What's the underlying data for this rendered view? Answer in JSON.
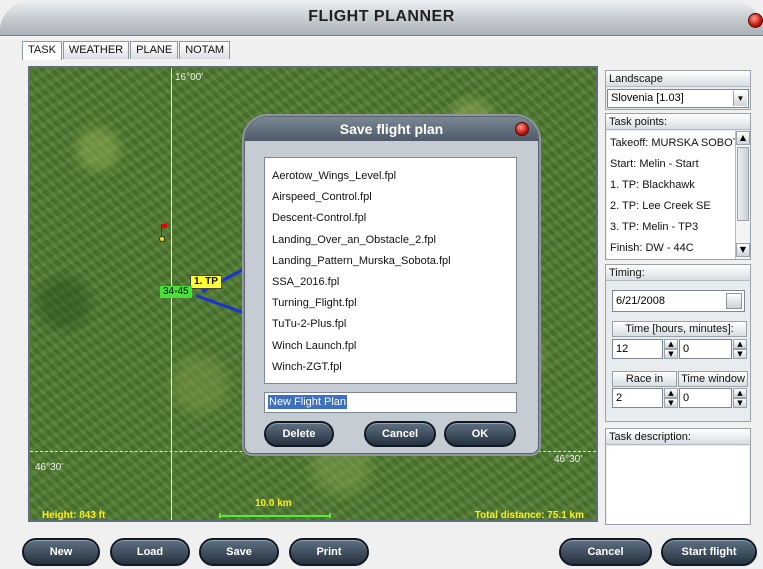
{
  "window": {
    "title": "FLIGHT PLANNER"
  },
  "tabs": [
    {
      "label": "TASK",
      "active": true
    },
    {
      "label": "WEATHER"
    },
    {
      "label": "PLANE"
    },
    {
      "label": "NOTAM"
    }
  ],
  "map": {
    "grid_top_label": "16°00'",
    "grid_left_label": "46°30'",
    "grid_right_label": "46°30'",
    "turnpoint_label": "1. TP",
    "sector_label": "34-45",
    "height": "Height: 843 ft",
    "scale": "10.0 km",
    "total_distance": "Total distance: 75.1 km"
  },
  "dialog": {
    "title": "Save flight plan",
    "files": [
      "Aerotow_Wings_Level.fpl",
      "Airspeed_Control.fpl",
      "Descent-Control.fpl",
      "Landing_Over_an_Obstacle_2.fpl",
      "Landing_Pattern_Murska_Sobota.fpl",
      "SSA_2016.fpl",
      "Turning_Flight.fpl",
      "TuTu-2-Plus.fpl",
      "Winch Launch.fpl",
      "Winch-ZGT.fpl"
    ],
    "filename": "New Flight Plan",
    "delete_label": "Delete",
    "cancel_label": "Cancel",
    "ok_label": "OK"
  },
  "panel": {
    "landscape_header": "Landscape",
    "landscape_value": "Slovenia [1.03]",
    "taskpoints_header": "Task points:",
    "taskpoints": [
      "Takeoff: MURSKA SOBOTA",
      "Start: Melin - Start",
      "1. TP: Blackhawk",
      "2. TP: Lee Creek SE",
      "3. TP: Melin - TP3",
      "Finish: DW - 44C"
    ],
    "timing_header": "Timing:",
    "date": "6/21/2008",
    "time_header": "Time [hours, minutes]:",
    "hours": "12",
    "minutes": "0",
    "race_header": "Race in",
    "window_header": "Time window",
    "race_value": "2",
    "window_value": "0",
    "description_header": "Task description:"
  },
  "buttons": {
    "new": "New",
    "load": "Load",
    "save": "Save",
    "print": "Print",
    "cancel": "Cancel",
    "start": "Start flight"
  }
}
